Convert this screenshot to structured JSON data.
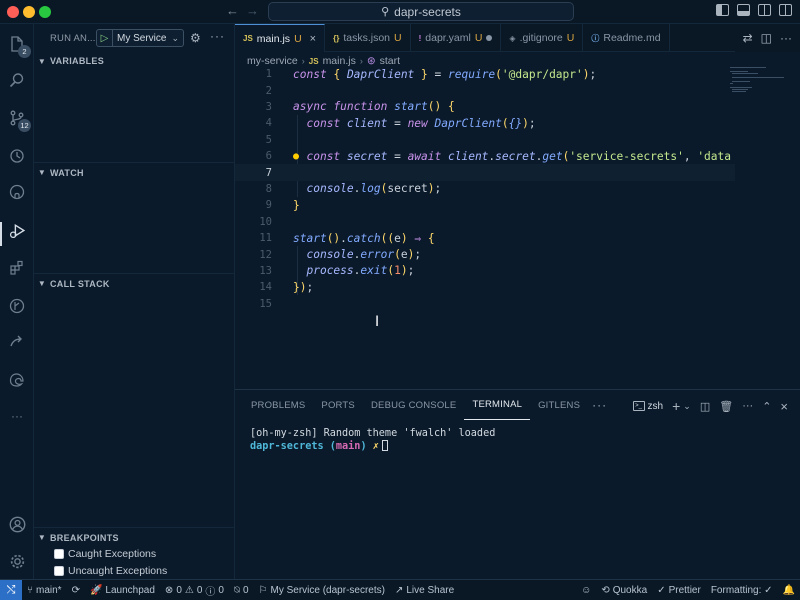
{
  "window": {
    "title": "dapr-secrets",
    "colors": {
      "accent": "#4f8fd6",
      "remote": "#2b6fc7",
      "background": "#0b1a2a"
    }
  },
  "activity_bar": {
    "items": [
      {
        "name": "explorer-icon",
        "badge": "2"
      },
      {
        "name": "search-icon",
        "badge": ""
      },
      {
        "name": "source-control-icon",
        "badge": "12"
      },
      {
        "name": "timeline-icon",
        "badge": ""
      },
      {
        "name": "github-icon",
        "badge": ""
      },
      {
        "name": "run-debug-icon",
        "badge": ""
      },
      {
        "name": "extensions-icon",
        "badge": ""
      },
      {
        "name": "git-graph-icon",
        "badge": ""
      },
      {
        "name": "live-share-icon",
        "badge": ""
      },
      {
        "name": "edge-icon",
        "badge": ""
      }
    ],
    "more": "···"
  },
  "sidebar": {
    "title": "RUN AN...",
    "config": "My Service",
    "sections": {
      "variables": "VARIABLES",
      "watch": "WATCH",
      "call_stack": "CALL STACK",
      "breakpoints": "BREAKPOINTS"
    },
    "breakpoints": [
      {
        "label": "Caught Exceptions",
        "checked": false
      },
      {
        "label": "Uncaught Exceptions",
        "checked": false
      }
    ]
  },
  "tabs": [
    {
      "type": "JS",
      "label": "main.js",
      "status": "U",
      "active": true
    },
    {
      "type": "{}",
      "label": "tasks.json",
      "status": "U",
      "active": false
    },
    {
      "type": "!",
      "label": "dapr.yaml",
      "status": "U",
      "active": false
    },
    {
      "type": "◈",
      "label": ".gitignore",
      "status": "U",
      "active": false
    },
    {
      "type": "ⓘ",
      "label": "Readme.md",
      "status": "",
      "active": false
    }
  ],
  "breadcrumb": {
    "folder": "my-service",
    "file_type": "JS",
    "file": "main.js",
    "symbol": "start"
  },
  "editor": {
    "current_line": 7,
    "line_numbers": [
      "1",
      "2",
      "3",
      "4",
      "5",
      "6",
      "7",
      "8",
      "9",
      "10",
      "11",
      "12",
      "13",
      "14",
      "15"
    ]
  },
  "panel": {
    "tabs": [
      "PROBLEMS",
      "PORTS",
      "DEBUG CONSOLE",
      "TERMINAL",
      "GITLENS"
    ],
    "active_tab": "TERMINAL",
    "shell": "zsh",
    "terminal": {
      "line1": "[oh-my-zsh] Random theme 'fwalch' loaded",
      "prompt_dir": "dapr-secrets",
      "prompt_branch": "main",
      "prompt_mark": "✗"
    }
  },
  "statusbar": {
    "branch": "main*",
    "launchpad": "Launchpad",
    "errors": "0",
    "warnings": "0",
    "info": "0",
    "ports": "0",
    "debug_config": "My Service (dapr-secrets)",
    "live_share": "Live Share",
    "quokka": "Quokka",
    "prettier": "Prettier",
    "formatting": "Formatting: ✓"
  }
}
